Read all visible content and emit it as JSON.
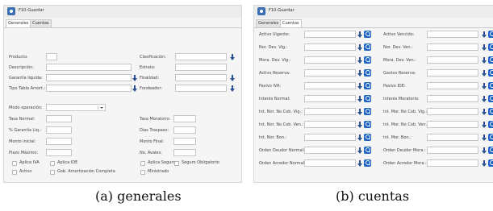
{
  "window_title": "F10-Guardar",
  "captions": {
    "a": "(a)  generales",
    "b": "(b)  cuentas"
  },
  "panel_a": {
    "tabs": [
      "Generales",
      "Cuentas"
    ],
    "left_fields": [
      "Producto:",
      "Descripción:",
      "Garantía liquida:",
      "Tipo Tabla Amort.:"
    ],
    "right_fields": [
      "Clasificación:",
      "Estrato:",
      "Finalidad:",
      "Fondeador:"
    ],
    "modo_label": "Modo operación:",
    "rates_left": [
      "Tasa Normal:",
      "% Garantía Liq.:",
      "Monto inicial:",
      "Plazo Máximo:"
    ],
    "rates_right": [
      "Tasa Moratorio:",
      "Días Traspaso:",
      "Monto Final:",
      "No. Avales:"
    ],
    "checks_row1_left": [
      "Aplica IVA",
      "Aplica IDE"
    ],
    "checks_row1_right": [
      "Aplica Seguro",
      "Seguro Obligatorio"
    ],
    "checks_row2_left": [
      "Activo",
      "Gob. Amortización Completa"
    ],
    "checks_row2_right": [
      "Ministrado"
    ]
  },
  "panel_b": {
    "tabs": [
      "Generales",
      "Cuentas"
    ],
    "left_fields": [
      "Activo Vigente:",
      "Nor. Dev. Vig.:",
      "Mora. Dev. Vig.:",
      "Activo Reserva:",
      "Pasivo IVA:",
      "Interés Normal:",
      "Int. Nor. No Cob. Vig.:",
      "Int. Nor. No Cob. Ven.:",
      "Int. Nor. Bon.:",
      "Orden Deudor Normal:",
      "Orden Acredor Normal:"
    ],
    "right_fields": [
      "Activo Vencido:",
      "Nor. Dev. Ven.:",
      "Mora. Dev. Ven.:",
      "Gastos Reserva:",
      "Pasivo IDE:",
      "Interés Moratorio:",
      "Int. Mor. No Cob. Vig.:",
      "Int. Mor. No Cob. Ven.:",
      "Int. Mor. Bon.:",
      "Orden Deudor Mora.:",
      "Orden Acredor Mora.:"
    ]
  }
}
